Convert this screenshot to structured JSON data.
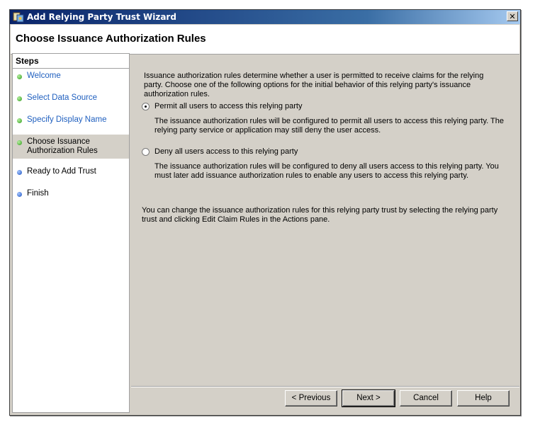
{
  "window": {
    "title": "Add Relying Party Trust Wizard",
    "close_glyph": "✕"
  },
  "header": {
    "title": "Choose Issuance Authorization Rules"
  },
  "steps": {
    "heading": "Steps",
    "items": [
      {
        "label": "Welcome",
        "state": "done"
      },
      {
        "label": "Select Data Source",
        "state": "done"
      },
      {
        "label": "Specify Display Name",
        "state": "done"
      },
      {
        "label": "Choose Issuance Authorization Rules",
        "state": "current"
      },
      {
        "label": "Ready to Add Trust",
        "state": "todo"
      },
      {
        "label": "Finish",
        "state": "todo"
      }
    ]
  },
  "main": {
    "intro": "Issuance authorization rules determine whether a user is permitted to receive claims for the relying party. Choose one of the following options for the initial behavior of this relying party's issuance authorization rules.",
    "options": [
      {
        "label": "Permit all users to access this relying party",
        "selected": true,
        "description": "The issuance authorization rules will be configured to permit all users to access this relying party. The relying party service or application may still deny the user access."
      },
      {
        "label": "Deny all users access to this relying party",
        "selected": false,
        "description": "The issuance authorization rules will be configured to deny all users access to this relying party. You must later add issuance authorization rules to enable any users to access this relying party."
      }
    ],
    "footnote": "You can change the issuance authorization rules for this relying party trust by selecting the relying party trust and clicking Edit Claim Rules in the Actions pane."
  },
  "buttons": {
    "previous": "< Previous",
    "next": "Next >",
    "cancel": "Cancel",
    "help": "Help"
  },
  "colors": {
    "link": "#1f5fbf",
    "done_dot": "#2e9a1a",
    "todo_dot": "#1a50c0",
    "titlebar": "#0a246a"
  }
}
